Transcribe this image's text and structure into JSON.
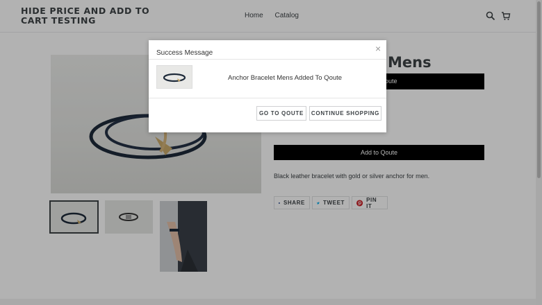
{
  "header": {
    "logo_line1": "HIDE PRICE AND ADD TO",
    "logo_line2": "CART TESTING",
    "nav": [
      "Home",
      "Catalog"
    ],
    "icons": [
      "search-icon",
      "cart-icon"
    ]
  },
  "product": {
    "title_partial": "Mens",
    "button_top_partial": "oute",
    "add_button": "Add to Qoute",
    "description": "Black leather bracelet with gold or silver anchor for men.",
    "share": [
      {
        "label": "SHARE",
        "icon": "facebook-icon",
        "color": "#3b5998"
      },
      {
        "label": "TWEET",
        "icon": "twitter-icon",
        "color": "#00aced"
      },
      {
        "label": "PIN IT",
        "icon": "pinterest-icon",
        "color": "#cb2027"
      }
    ]
  },
  "modal": {
    "title": "Success Message",
    "close": "×",
    "message": "Anchor Bracelet Mens Added To Qoute",
    "buttons": {
      "go_to": "GO TO QOUTE",
      "continue": "CONTINUE SHOPPING"
    }
  }
}
